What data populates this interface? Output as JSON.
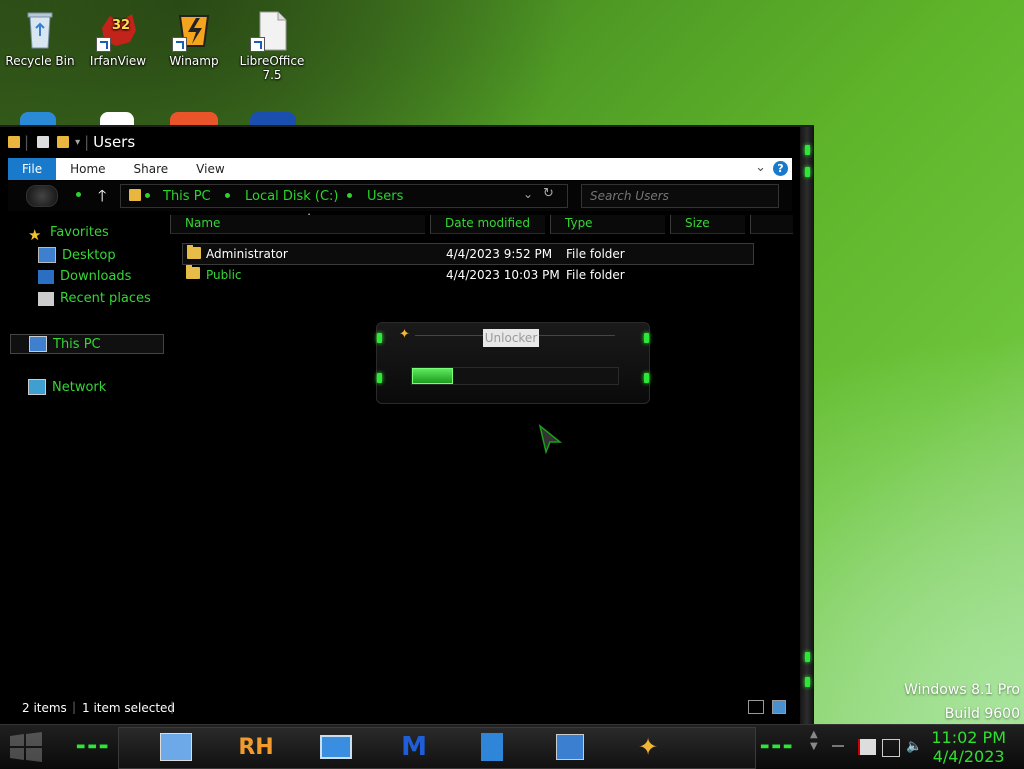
{
  "desktop": {
    "icons": [
      {
        "label": "Recycle Bin"
      },
      {
        "label": "IrfanView",
        "badge": "32"
      },
      {
        "label": "Winamp"
      },
      {
        "label": "LibreOffice 7.5"
      }
    ],
    "watermark": {
      "line1": "Windows 8.1 Pro",
      "line2": "Build 9600"
    }
  },
  "window": {
    "title": "Users",
    "ribbon_tabs": [
      "File",
      "Home",
      "Share",
      "View"
    ],
    "breadcrumbs": [
      "This PC",
      "Local Disk (C:)",
      "Users"
    ],
    "search_placeholder": "Search Users",
    "nav": {
      "favorites": "Favorites",
      "desktop": "Desktop",
      "downloads": "Downloads",
      "recent": "Recent places",
      "this_pc": "This PC",
      "network": "Network"
    },
    "columns": [
      "Name",
      "Date modified",
      "Type",
      "Size"
    ],
    "files": [
      {
        "name": "Administrator",
        "date": "4/4/2023 9:52 PM",
        "type": "File folder"
      },
      {
        "name": "Public",
        "date": "4/4/2023 10:03 PM",
        "type": "File folder"
      }
    ],
    "status": {
      "items": "2 items",
      "selected": "1 item selected"
    }
  },
  "dialog": {
    "title": "Unlocker",
    "progress": 0.2
  },
  "taskbar": {
    "rh_label": "RH",
    "clock": {
      "time": "11:02 PM",
      "date": "4/4/2023"
    }
  },
  "colors": {
    "accent": "#2fd62f",
    "file_tab": "#1979ca"
  }
}
